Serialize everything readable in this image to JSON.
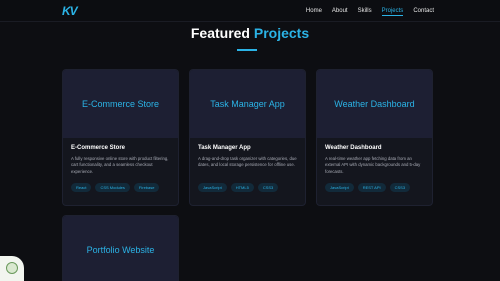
{
  "brand": {
    "logo_text": "KV"
  },
  "nav": {
    "items": [
      {
        "label": "Home"
      },
      {
        "label": "About"
      },
      {
        "label": "Skills"
      },
      {
        "label": "Projects",
        "active": true
      },
      {
        "label": "Contact"
      }
    ]
  },
  "section": {
    "title_main": "Featured",
    "title_accent": "Projects"
  },
  "projects": [
    {
      "media_label": "E-Commerce Store",
      "title": "E-Commerce Store",
      "description": "A fully responsive online store with product filtering, cart functionality, and a seamless checkout experience.",
      "tags": [
        "React",
        "CSS Modules",
        "Firebase"
      ]
    },
    {
      "media_label": "Task Manager App",
      "title": "Task Manager App",
      "description": "A drag-and-drop task organizer with categories, due dates, and local storage persistence for offline use.",
      "tags": [
        "JavaScript",
        "HTML5",
        "CSS3"
      ]
    },
    {
      "media_label": "Weather Dashboard",
      "title": "Weather Dashboard",
      "description": "A real-time weather app fetching data from an external API with dynamic backgrounds and 5-day forecasts.",
      "tags": [
        "JavaScript",
        "REST API",
        "CSS3"
      ]
    },
    {
      "media_label": "Portfolio Website"
    }
  ],
  "colors": {
    "accent": "#2bb3e6",
    "background": "#0d0e12",
    "card": "#14161e"
  }
}
